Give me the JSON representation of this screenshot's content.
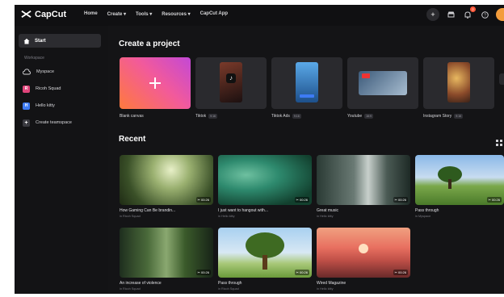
{
  "header": {
    "brand": "CapCut",
    "nav": [
      "Home",
      "Create ▾",
      "Tools ▾",
      "Resources ▾",
      "CapCut App"
    ],
    "notification_count": "2",
    "icons": [
      "plus-icon",
      "store-icon",
      "bell-icon",
      "help-icon",
      "avatar"
    ]
  },
  "sidebar": {
    "start": "Start",
    "section_label": "Workspace",
    "items": [
      {
        "label": "Myspace",
        "icon": "cloud-icon"
      },
      {
        "label": "Ricoh Squad",
        "initial": "R",
        "color": "#e0457b"
      },
      {
        "label": "Hello kitty",
        "initial": "H",
        "color": "#3d7bf5"
      },
      {
        "label": "Create teamspace",
        "icon": "plus-icon"
      }
    ]
  },
  "main": {
    "create_title": "Create a project",
    "projects": [
      {
        "label": "Blank canvas",
        "tag": ""
      },
      {
        "label": "Tiktok",
        "tag": "9:16"
      },
      {
        "label": "Tiktok Ads",
        "tag": "9:16"
      },
      {
        "label": "Youtube",
        "tag": "16:9"
      },
      {
        "label": "Instagram Story",
        "tag": "9:16"
      }
    ],
    "recent_title": "Recent",
    "recent": [
      {
        "title": "How Gaming Can Be brandin...",
        "sub": "in Ricoh Squad",
        "duration": "00:26"
      },
      {
        "title": "I just want to hangout with...",
        "sub": "in Hello kitty",
        "duration": "00:26"
      },
      {
        "title": "Great music",
        "sub": "in Hello kitty",
        "duration": "00:26"
      },
      {
        "title": "Pass through",
        "sub": "in Myspace",
        "duration": "00:26"
      },
      {
        "title": "An increase of violence",
        "sub": "in Ricoh Squad",
        "duration": "00:26"
      },
      {
        "title": "Pass through",
        "sub": "in Ricoh Squad",
        "duration": "00:26"
      },
      {
        "title": "Wired Magazine",
        "sub": "in Hello kitty",
        "duration": "00:26"
      }
    ]
  }
}
